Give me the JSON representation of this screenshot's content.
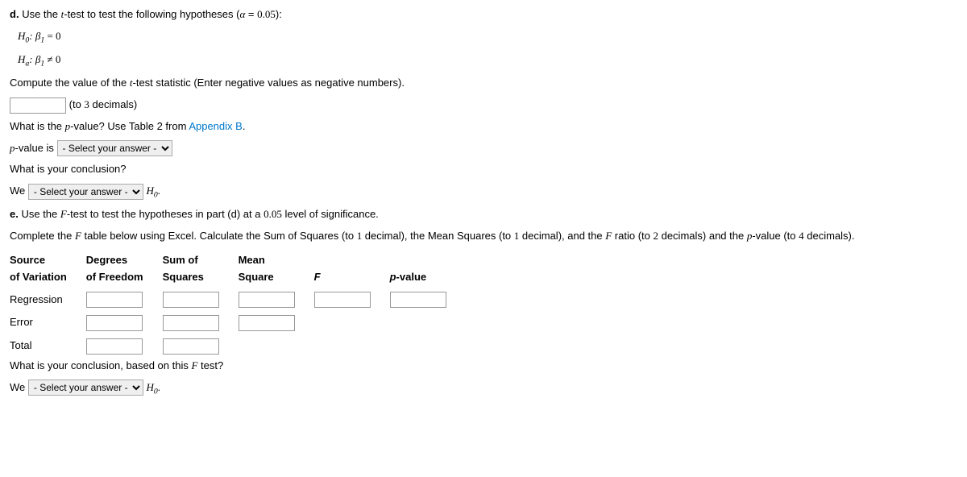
{
  "partD": {
    "label": "d.",
    "intro": "Use the t-test to test the following hypotheses (α = 0.05):",
    "h0": "H",
    "h0sub": "0",
    "h0text": ": β",
    "h0sub2": "1",
    "h0tail": " = 0",
    "ha": "H",
    "hasub": "a",
    "hatext": ": β",
    "hasub2": "1",
    "hatail": " ≠ 0",
    "compute": "Compute the value of the t-test statistic (Enter negative values as negative numbers).",
    "decimals": "(to 3 decimals)",
    "pvalueQ": "What is the p-value? Use Table 2 from ",
    "appendix": "Appendix B",
    "pvalueIs": "p-value is",
    "conclusionQ": "What is your conclusion?",
    "we": "We",
    "h0dot": "."
  },
  "partE": {
    "label": "e.",
    "intro": "Use the F-test to test the hypotheses in part (d) at a 0.05 level of significance.",
    "complete": "Complete the F table below using Excel. Calculate the Sum of Squares (to 1 decimal), the Mean Squares (to 1 decimal), and the F ratio (to 2 decimals) and the p-value (to 4 decimals).",
    "headers": {
      "source1": "Source",
      "source2": "of Variation",
      "degrees1": "Degrees",
      "degrees2": "of Freedom",
      "sum1": "Sum of",
      "sum2": "Squares",
      "mean1": "Mean",
      "mean2": "Square",
      "f": "F",
      "pvalue": "p-value"
    },
    "rows": {
      "regression": "Regression",
      "error": "Error",
      "total": "Total"
    },
    "conclusionQ": "What is your conclusion, based on this F test?",
    "we": "We",
    "h0dot": "."
  },
  "select": {
    "placeholder": "- Select your answer -"
  }
}
